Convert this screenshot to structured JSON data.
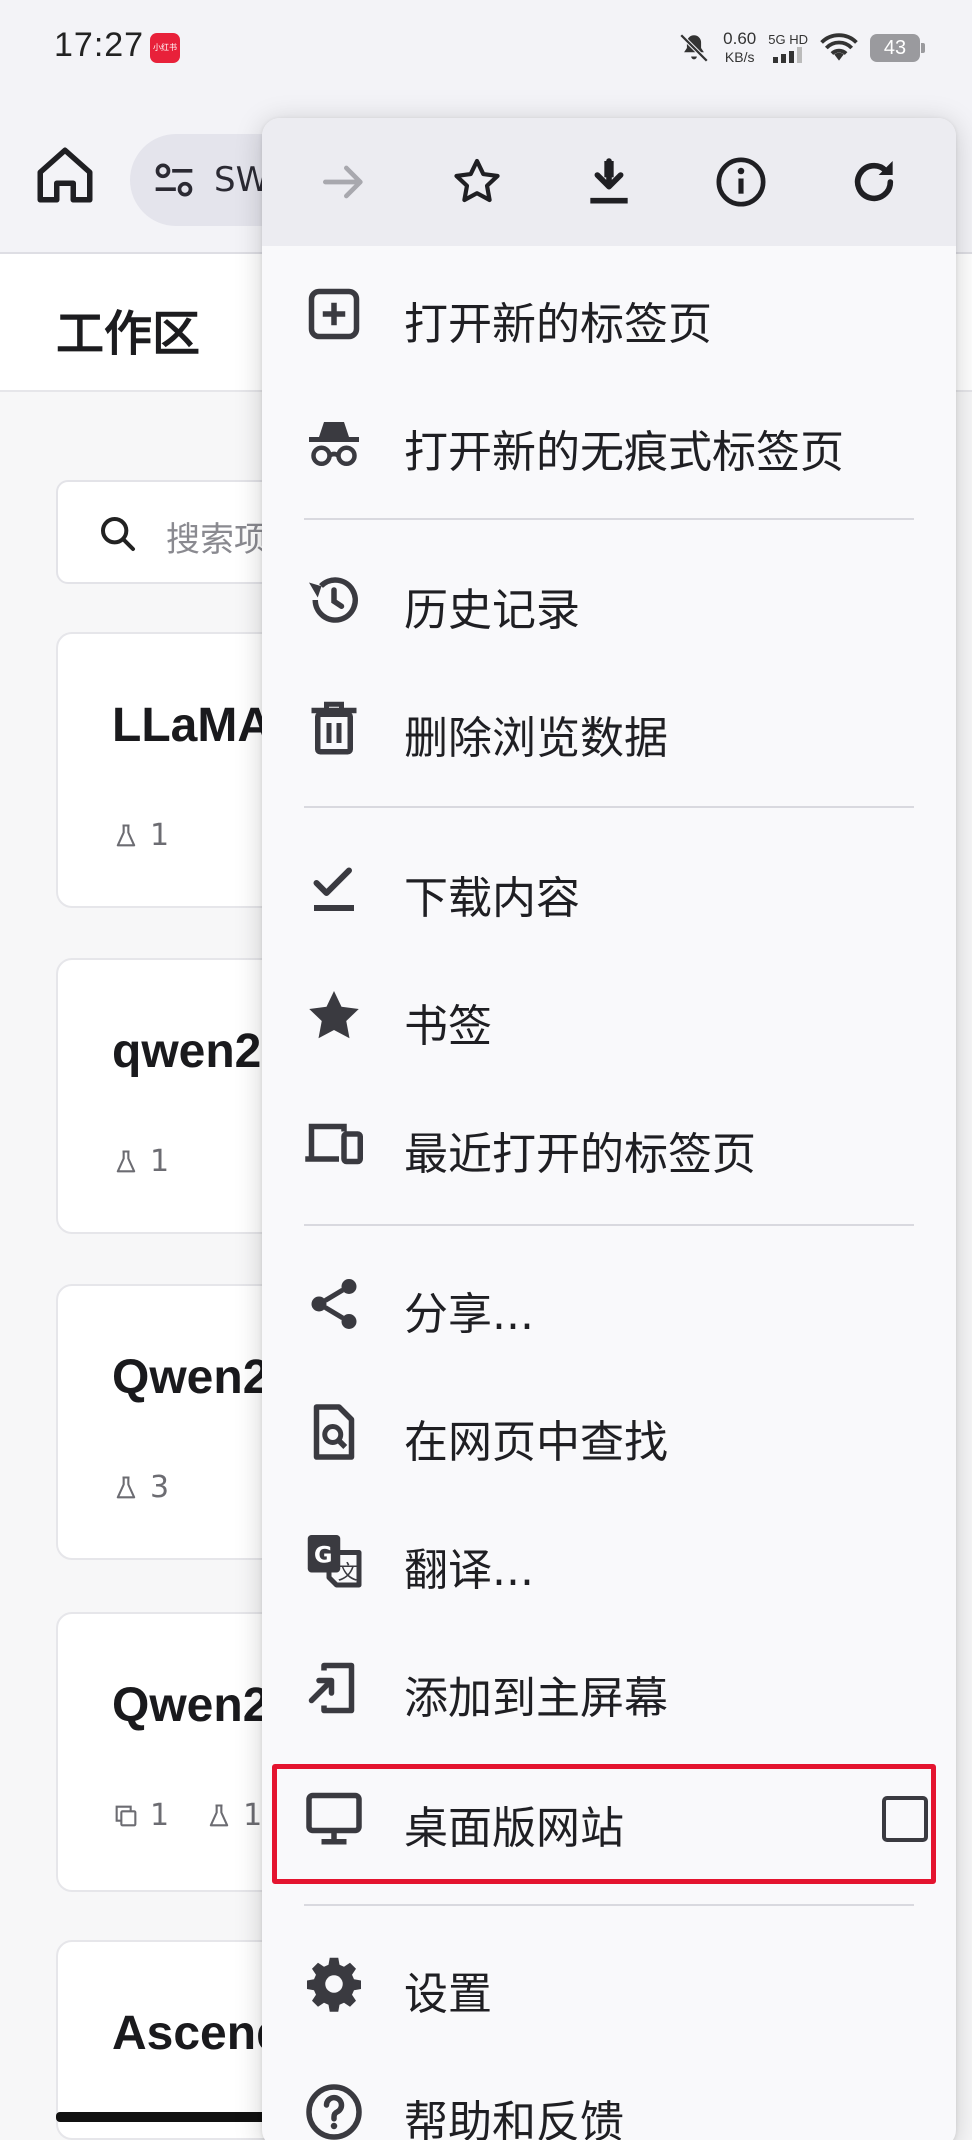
{
  "status": {
    "time": "17:27",
    "app_badge": "小红书",
    "net_speed_value": "0.60",
    "net_speed_unit": "KB/s",
    "net_type": "5G HD",
    "battery": "43"
  },
  "toolbar": {
    "url_text": "SW"
  },
  "page": {
    "title": "工作区",
    "search_placeholder": "搜索项",
    "cards": [
      {
        "title": "LLaMA",
        "meta": [
          {
            "icon": "flask-icon",
            "count": "1"
          }
        ]
      },
      {
        "title": "qwen2",
        "meta": [
          {
            "icon": "flask-icon",
            "count": "1"
          }
        ]
      },
      {
        "title": "Qwen2",
        "meta": [
          {
            "icon": "flask-icon",
            "count": "3"
          }
        ]
      },
      {
        "title": "Qwen2",
        "meta": [
          {
            "icon": "copy-icon",
            "count": "1"
          },
          {
            "icon": "flask-icon",
            "count": "1"
          }
        ]
      },
      {
        "title": "Ascend",
        "meta": []
      }
    ]
  },
  "menu": {
    "actions": [
      "forward-arrow-icon",
      "bookmark-star-icon",
      "download-icon",
      "info-icon",
      "reload-icon"
    ],
    "items": [
      {
        "icon": "new-tab-icon",
        "label": "打开新的标签页"
      },
      {
        "icon": "incognito-icon",
        "label": "打开新的无痕式标签页"
      },
      {
        "icon": "history-icon",
        "label": "历史记录"
      },
      {
        "icon": "trash-icon",
        "label": "删除浏览数据"
      },
      {
        "icon": "downloads-icon",
        "label": "下载内容"
      },
      {
        "icon": "bookmark-icon",
        "label": "书签"
      },
      {
        "icon": "recent-tabs-icon",
        "label": "最近打开的标签页"
      },
      {
        "icon": "share-icon",
        "label": "分享..."
      },
      {
        "icon": "find-in-page-icon",
        "label": "在网页中查找"
      },
      {
        "icon": "translate-icon",
        "label": "翻译..."
      },
      {
        "icon": "add-to-home-icon",
        "label": "添加到主屏幕"
      },
      {
        "icon": "desktop-icon",
        "label": "桌面版网站",
        "checked": false
      },
      {
        "icon": "settings-gear-icon",
        "label": "设置"
      },
      {
        "icon": "help-icon",
        "label": "帮助和反馈"
      }
    ]
  },
  "colors": {
    "highlight": "#e4142f",
    "menu_bg": "#f9f9fb",
    "icon": "#3a3a40"
  }
}
